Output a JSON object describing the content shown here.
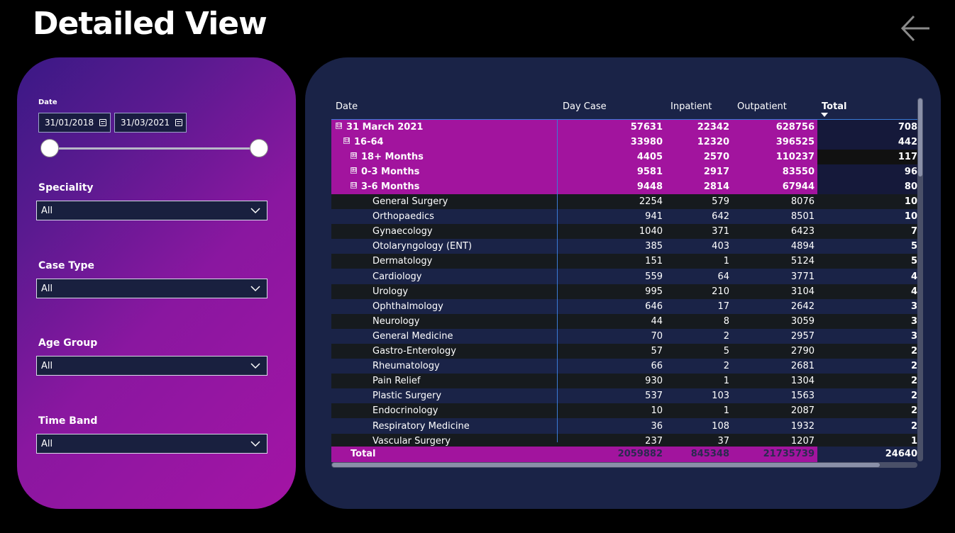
{
  "page": {
    "title": "Detailed View"
  },
  "filters": {
    "date": {
      "label": "Date",
      "start": "31/01/2018",
      "end": "31/03/2021"
    },
    "speciality": {
      "label": "Speciality",
      "value": "All"
    },
    "case_type": {
      "label": "Case Type",
      "value": "All"
    },
    "age_group": {
      "label": "Age Group",
      "value": "All"
    },
    "time_band": {
      "label": "Time Band",
      "value": "All"
    }
  },
  "table": {
    "columns": [
      "Date",
      "Day Case",
      "Inpatient",
      "Outpatient",
      "Total"
    ],
    "sorted_column": "Total",
    "groups": [
      {
        "label": "31 March 2021",
        "expander": "⊟",
        "day_case": "57631",
        "inpatient": "22342",
        "outpatient": "628756",
        "total": "708"
      },
      {
        "label": "16-64",
        "expander": "⊟",
        "day_case": "33980",
        "inpatient": "12320",
        "outpatient": "396525",
        "total": "442"
      },
      {
        "label": "18+ Months",
        "expander": "⊞",
        "day_case": "4405",
        "inpatient": "2570",
        "outpatient": "110237",
        "total": "117"
      },
      {
        "label": "0-3 Months",
        "expander": "⊞",
        "day_case": "9581",
        "inpatient": "2917",
        "outpatient": "83550",
        "total": "96"
      },
      {
        "label": "3-6 Months",
        "expander": "⊟",
        "day_case": "9448",
        "inpatient": "2814",
        "outpatient": "67944",
        "total": "80"
      }
    ],
    "rows": [
      {
        "label": "General Surgery",
        "day_case": "2254",
        "inpatient": "579",
        "outpatient": "8076",
        "total": "10"
      },
      {
        "label": "Orthopaedics",
        "day_case": "941",
        "inpatient": "642",
        "outpatient": "8501",
        "total": "10"
      },
      {
        "label": "Gynaecology",
        "day_case": "1040",
        "inpatient": "371",
        "outpatient": "6423",
        "total": "7"
      },
      {
        "label": "Otolaryngology (ENT)",
        "day_case": "385",
        "inpatient": "403",
        "outpatient": "4894",
        "total": "5"
      },
      {
        "label": "Dermatology",
        "day_case": "151",
        "inpatient": "1",
        "outpatient": "5124",
        "total": "5"
      },
      {
        "label": "Cardiology",
        "day_case": "559",
        "inpatient": "64",
        "outpatient": "3771",
        "total": "4"
      },
      {
        "label": "Urology",
        "day_case": "995",
        "inpatient": "210",
        "outpatient": "3104",
        "total": "4"
      },
      {
        "label": "Ophthalmology",
        "day_case": "646",
        "inpatient": "17",
        "outpatient": "2642",
        "total": "3"
      },
      {
        "label": "Neurology",
        "day_case": "44",
        "inpatient": "8",
        "outpatient": "3059",
        "total": "3"
      },
      {
        "label": "General Medicine",
        "day_case": "70",
        "inpatient": "2",
        "outpatient": "2957",
        "total": "3"
      },
      {
        "label": "Gastro-Enterology",
        "day_case": "57",
        "inpatient": "5",
        "outpatient": "2790",
        "total": "2"
      },
      {
        "label": "Rheumatology",
        "day_case": "66",
        "inpatient": "2",
        "outpatient": "2681",
        "total": "2"
      },
      {
        "label": "Pain Relief",
        "day_case": "930",
        "inpatient": "1",
        "outpatient": "1304",
        "total": "2"
      },
      {
        "label": "Plastic Surgery",
        "day_case": "537",
        "inpatient": "103",
        "outpatient": "1563",
        "total": "2"
      },
      {
        "label": "Endocrinology",
        "day_case": "10",
        "inpatient": "1",
        "outpatient": "2087",
        "total": "2"
      },
      {
        "label": "Respiratory Medicine",
        "day_case": "36",
        "inpatient": "108",
        "outpatient": "1932",
        "total": "2"
      },
      {
        "label": "Vascular Surgery",
        "day_case": "237",
        "inpatient": "37",
        "outpatient": "1207",
        "total": "1"
      }
    ],
    "totals": {
      "label": "Total",
      "day_case": "2059882",
      "inpatient": "845348",
      "outpatient": "21735739",
      "total": "24640"
    }
  },
  "colors": {
    "accent": "#a2149e",
    "panel": "#1a2347",
    "background": "#000000"
  }
}
